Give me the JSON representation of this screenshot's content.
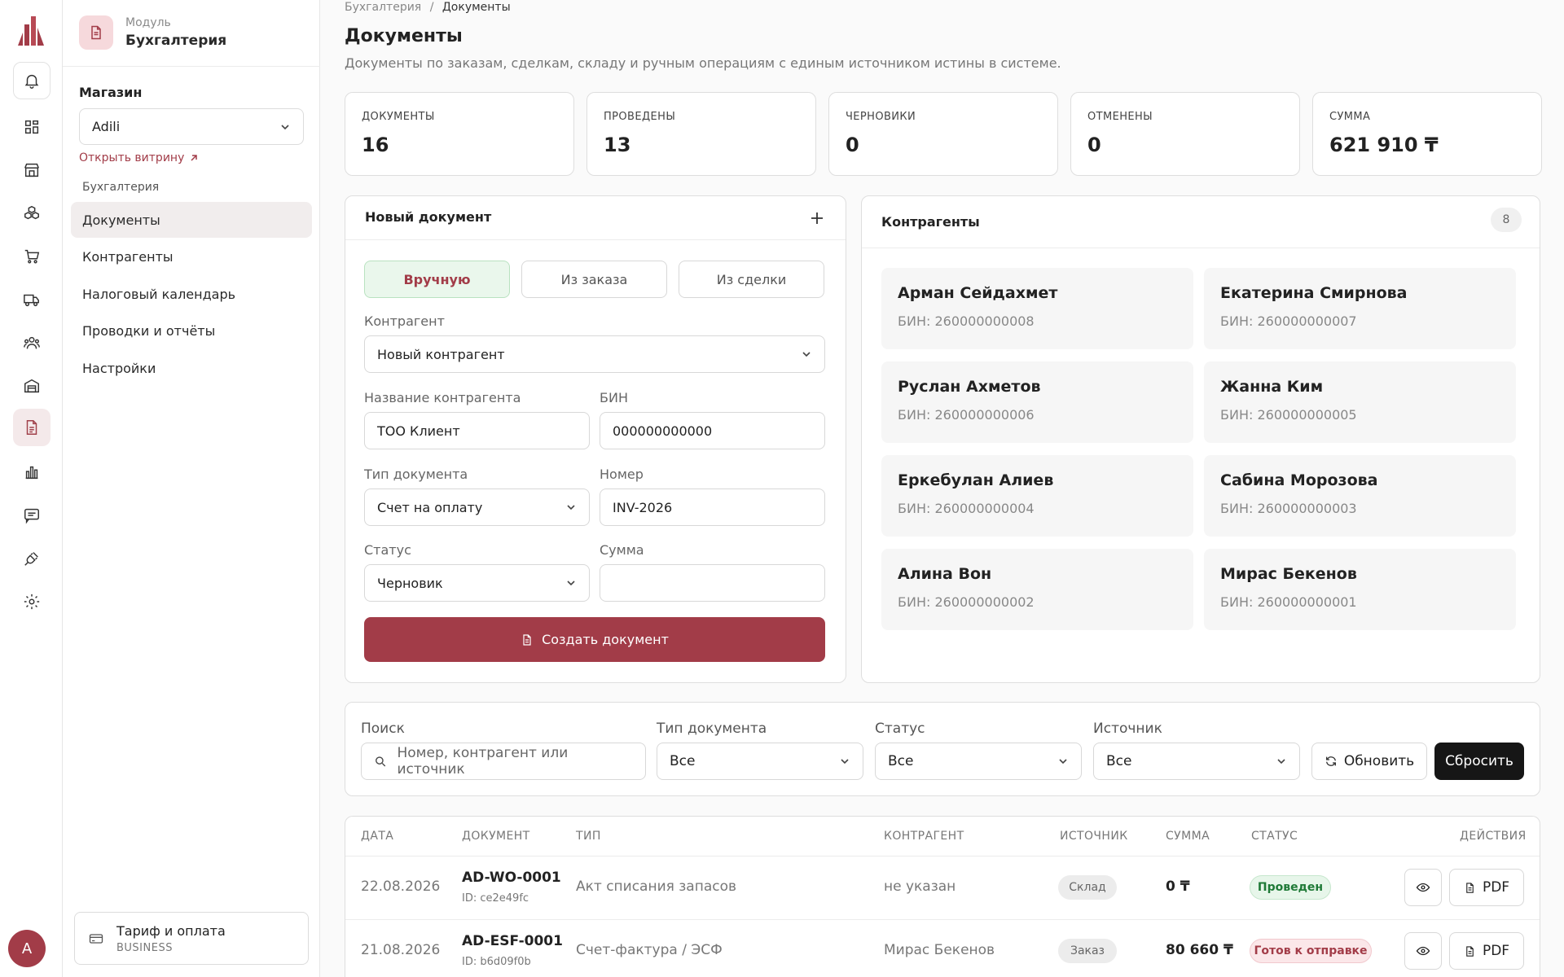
{
  "rail": {
    "items": [
      "bell-icon",
      "dashboard-icon",
      "store-icon",
      "boxes-icon",
      "cart-icon",
      "truck-icon",
      "users-icon",
      "warehouse-icon",
      "document-icon",
      "chart-icon",
      "chat-icon",
      "plug-icon",
      "gear-icon"
    ],
    "avatar": "A"
  },
  "sidebar": {
    "module_caption": "Модуль",
    "module_name": "Бухгалтерия",
    "shop_label": "Магазин",
    "shop_value": "Adili",
    "open_store": "Открыть витрину",
    "group_label": "Бухгалтерия",
    "items": [
      {
        "label": "Документы"
      },
      {
        "label": "Контрагенты"
      },
      {
        "label": "Налоговый календарь"
      },
      {
        "label": "Проводки и отчёты"
      },
      {
        "label": "Настройки"
      }
    ],
    "plan_title": "Тариф и оплата",
    "plan_tier": "BUSINESS"
  },
  "header": {
    "crumb_parent": "Бухгалтерия",
    "crumb_sep": "/",
    "crumb_current": "Документы",
    "title": "Документы",
    "subtitle": "Документы по заказам, сделкам, складу и ручным операциям с единым источником истины в системе."
  },
  "stats": [
    {
      "label": "ДОКУМЕНТЫ",
      "value": "16"
    },
    {
      "label": "ПРОВЕДЕНЫ",
      "value": "13"
    },
    {
      "label": "ЧЕРНОВИКИ",
      "value": "0"
    },
    {
      "label": "ОТМЕНЕНЫ",
      "value": "0"
    },
    {
      "label": "СУММА",
      "value": "621 910 ₸"
    }
  ],
  "new_doc": {
    "title": "Новый документ",
    "tabs": [
      "Вручную",
      "Из заказа",
      "Из сделки"
    ],
    "counterparty_label": "Контрагент",
    "counterparty_value": "Новый контрагент",
    "name_label": "Название контрагента",
    "name_value": "ТОО Клиент",
    "bin_label": "БИН",
    "bin_value": "000000000000",
    "type_label": "Тип документа",
    "type_value": "Счет на оплату",
    "number_label": "Номер",
    "number_value": "INV-2026",
    "status_label": "Статус",
    "status_value": "Черновик",
    "sum_label": "Сумма",
    "sum_value": "",
    "create_btn": "Создать документ"
  },
  "counterparties": {
    "title": "Контрагенты",
    "count": "8",
    "items": [
      {
        "name": "Арман Сейдахмет",
        "bin": "БИН: 260000000008"
      },
      {
        "name": "Екатерина Смирнова",
        "bin": "БИН: 260000000007"
      },
      {
        "name": "Руслан Ахметов",
        "bin": "БИН: 260000000006"
      },
      {
        "name": "Жанна Ким",
        "bin": "БИН: 260000000005"
      },
      {
        "name": "Еркебулан Алиев",
        "bin": "БИН: 260000000004"
      },
      {
        "name": "Сабина Морозова",
        "bin": "БИН: 260000000003"
      },
      {
        "name": "Алина Вон",
        "bin": "БИН: 260000000002"
      },
      {
        "name": "Мирас Бекенов",
        "bin": "БИН: 260000000001"
      }
    ]
  },
  "filters": {
    "search_label": "Поиск",
    "search_placeholder": "Номер, контрагент или источник",
    "type_label": "Тип документа",
    "type_value": "Все",
    "status_label": "Статус",
    "status_value": "Все",
    "source_label": "Источник",
    "source_value": "Все",
    "refresh": "Обновить",
    "reset": "Сбросить"
  },
  "table": {
    "headers": [
      "ДАТА",
      "ДОКУМЕНТ",
      "ТИП",
      "КОНТРАГЕНТ",
      "ИСТОЧНИК",
      "СУММА",
      "СТАТУС",
      "ДЕЙСТВИЯ"
    ],
    "pdf_label": "PDF",
    "rows": [
      {
        "date": "22.08.2026",
        "doc": "AD-WO-0001",
        "id": "ID: ce2e49fc",
        "type": "Акт списания запасов",
        "party": "не указан",
        "source": "Склад",
        "sum": "0 ₸",
        "status": "Проведен",
        "status_kind": "ok"
      },
      {
        "date": "21.08.2026",
        "doc": "AD-ESF-0001",
        "id": "ID: b6d09f0b",
        "type": "Счет-фактура / ЭСФ",
        "party": "Мирас Бекенов",
        "source": "Заказ",
        "sum": "80 660 ₸",
        "status": "Готов к отправке",
        "status_kind": "warn"
      }
    ]
  }
}
